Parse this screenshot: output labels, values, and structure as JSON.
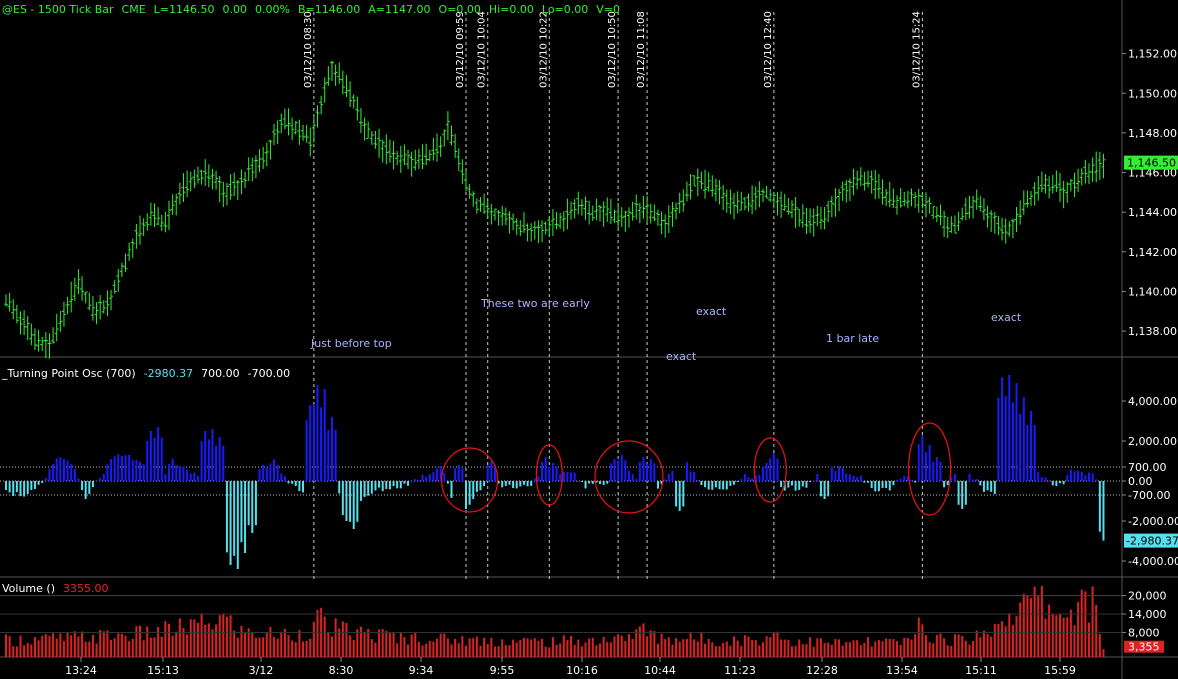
{
  "colors": {
    "background": "#000000",
    "price_bar": "#33ee33",
    "osc_positive": "#1a1aff",
    "osc_negative": "#55e0ee",
    "volume": "#dd2222",
    "annotation": "#aab4ff",
    "marker_line": "#cccccc",
    "circle": "#ee1111",
    "axis_text": "#ffffff",
    "last_price_bg": "#33ee33",
    "last_osc_bg": "#55e0ee",
    "last_vol_bg": "#dd2222"
  },
  "price_panel": {
    "header": {
      "symbol": "@ES - 1500 Tick Bar",
      "exchange": "CME",
      "last": "L=1146.50",
      "change": "0.00",
      "change_pct": "0.00%",
      "bid": "B=1146.00",
      "ask": "A=1147.00",
      "open": "O=0.00",
      "high": "Hi=0.00",
      "low": "Lo=0.00",
      "volume": "V=0"
    },
    "y_ticks": [
      "1,152.00",
      "1,150.00",
      "1,148.00",
      "1,146.00",
      "1,144.00",
      "1,142.00",
      "1,140.00",
      "1,138.00"
    ],
    "last_price_label": "1,146.50",
    "marker_labels": [
      "03/12/10 08:30",
      "03/12/10 09:59",
      "03/12/10 10:04",
      "03/12/10 10:22",
      "03/12/10 10:50",
      "03/12/10 11:08",
      "03/12/10 12:40",
      "03/12/10 15:24"
    ],
    "annotations": [
      "Just before top",
      "These two are early",
      "exact",
      "exact",
      "1 bar late",
      "exact"
    ]
  },
  "osc_panel": {
    "header": {
      "name": "_Turning Point Osc (700)",
      "value": "-2980.37",
      "upper": "700.00",
      "lower": "-700.00"
    },
    "y_ticks": [
      "4,000.00",
      "2,000.00",
      "700.00",
      "0.00",
      "-700.00",
      "-2,000.00",
      "-4,000.00"
    ],
    "last_value_label": "-2,980.37"
  },
  "volume_panel": {
    "header": {
      "name": "Volume ()",
      "value": "3355.00"
    },
    "y_ticks": [
      "20,000",
      "14,000",
      "8,000"
    ],
    "last_value_label": "3,355"
  },
  "x_axis_labels": [
    "13:24",
    "15:13",
    "3/12",
    "8:30",
    "9:34",
    "9:55",
    "10:16",
    "10:44",
    "11:23",
    "12:28",
    "13:54",
    "15:11",
    "15:59"
  ],
  "chart_data": {
    "type": "bar",
    "title": "@ES - 1500 Tick Bar",
    "price_anchors": [
      [
        0,
        1139.5
      ],
      [
        4,
        1138.6
      ],
      [
        8,
        1137.6
      ],
      [
        12,
        1137.3
      ],
      [
        16,
        1139.0
      ],
      [
        20,
        1140.4
      ],
      [
        24,
        1139.0
      ],
      [
        28,
        1139.3
      ],
      [
        32,
        1141.0
      ],
      [
        36,
        1142.8
      ],
      [
        40,
        1143.8
      ],
      [
        44,
        1143.5
      ],
      [
        48,
        1145.0
      ],
      [
        52,
        1145.7
      ],
      [
        56,
        1146.0
      ],
      [
        60,
        1145.0
      ],
      [
        64,
        1145.3
      ],
      [
        68,
        1146.2
      ],
      [
        72,
        1147.0
      ],
      [
        76,
        1148.6
      ],
      [
        80,
        1148.3
      ],
      [
        84,
        1147.6
      ],
      [
        86,
        1148.8
      ],
      [
        88,
        1150.3
      ],
      [
        90,
        1151.3
      ],
      [
        92,
        1150.8
      ],
      [
        94,
        1150.3
      ],
      [
        96,
        1149.5
      ],
      [
        100,
        1148.0
      ],
      [
        104,
        1147.3
      ],
      [
        108,
        1146.8
      ],
      [
        112,
        1146.5
      ],
      [
        116,
        1146.7
      ],
      [
        120,
        1147.4
      ],
      [
        122,
        1148.3
      ],
      [
        124,
        1147.3
      ],
      [
        126,
        1146.0
      ],
      [
        128,
        1145.0
      ],
      [
        130,
        1144.4
      ],
      [
        134,
        1144.0
      ],
      [
        138,
        1143.7
      ],
      [
        142,
        1143.3
      ],
      [
        146,
        1143.0
      ],
      [
        150,
        1143.3
      ],
      [
        154,
        1143.7
      ],
      [
        158,
        1144.5
      ],
      [
        162,
        1144.0
      ],
      [
        166,
        1144.0
      ],
      [
        170,
        1143.6
      ],
      [
        174,
        1144.2
      ],
      [
        178,
        1144.0
      ],
      [
        182,
        1143.5
      ],
      [
        186,
        1144.3
      ],
      [
        190,
        1145.6
      ],
      [
        194,
        1145.3
      ],
      [
        198,
        1144.8
      ],
      [
        202,
        1144.3
      ],
      [
        206,
        1144.6
      ],
      [
        210,
        1145.0
      ],
      [
        214,
        1144.5
      ],
      [
        218,
        1144.0
      ],
      [
        222,
        1143.4
      ],
      [
        226,
        1143.8
      ],
      [
        230,
        1144.8
      ],
      [
        234,
        1145.5
      ],
      [
        238,
        1145.7
      ],
      [
        242,
        1145.0
      ],
      [
        246,
        1144.5
      ],
      [
        250,
        1144.8
      ],
      [
        254,
        1144.5
      ],
      [
        258,
        1143.6
      ],
      [
        262,
        1143.2
      ],
      [
        264,
        1143.9
      ],
      [
        268,
        1144.6
      ],
      [
        272,
        1143.8
      ],
      [
        276,
        1143.0
      ],
      [
        278,
        1143.4
      ],
      [
        282,
        1144.6
      ],
      [
        286,
        1145.3
      ],
      [
        290,
        1145.5
      ],
      [
        292,
        1145.0
      ],
      [
        294,
        1145.3
      ],
      [
        298,
        1146.0
      ],
      [
        302,
        1146.4
      ]
    ],
    "price_markers": [
      85,
      127,
      133,
      150,
      169,
      177,
      212,
      253
    ],
    "volume_anchors": [
      [
        0,
        6000
      ],
      [
        20,
        7000
      ],
      [
        40,
        8500
      ],
      [
        55,
        12000
      ],
      [
        60,
        14000
      ],
      [
        65,
        9000
      ],
      [
        70,
        8500
      ],
      [
        80,
        8000
      ],
      [
        85,
        10000
      ],
      [
        86,
        16000
      ],
      [
        88,
        11000
      ],
      [
        95,
        9000
      ],
      [
        110,
        7000
      ],
      [
        130,
        6000
      ],
      [
        150,
        5500
      ],
      [
        170,
        6500
      ],
      [
        175,
        10000
      ],
      [
        180,
        7000
      ],
      [
        200,
        6000
      ],
      [
        210,
        6500
      ],
      [
        212,
        10000
      ],
      [
        215,
        6000
      ],
      [
        230,
        5000
      ],
      [
        250,
        5500
      ],
      [
        252,
        12000
      ],
      [
        256,
        7000
      ],
      [
        262,
        6000
      ],
      [
        270,
        8000
      ],
      [
        274,
        13000
      ],
      [
        280,
        18000
      ],
      [
        285,
        21000
      ],
      [
        290,
        16000
      ],
      [
        295,
        17000
      ],
      [
        300,
        20000
      ],
      [
        303,
        3355
      ]
    ],
    "x_categories": [
      "13:24",
      "15:13",
      "3/12",
      "8:30",
      "9:34",
      "9:55",
      "10:16",
      "10:44",
      "11:23",
      "12:28",
      "13:54",
      "15:11",
      "15:59"
    ],
    "xlabel": "",
    "ylabel": "",
    "series": [
      {
        "name": "_Turning Point Osc (700)",
        "type": "bar",
        "last_value": -2980.37,
        "levels": [
          700,
          0,
          -700
        ],
        "ylim": [
          -4700,
          5000
        ]
      },
      {
        "name": "Volume ()",
        "type": "bar",
        "last_value": 3355,
        "ylim": [
          0,
          22000
        ]
      }
    ],
    "price_ylim": [
      1135.5,
      1153.2
    ],
    "grid": false
  }
}
